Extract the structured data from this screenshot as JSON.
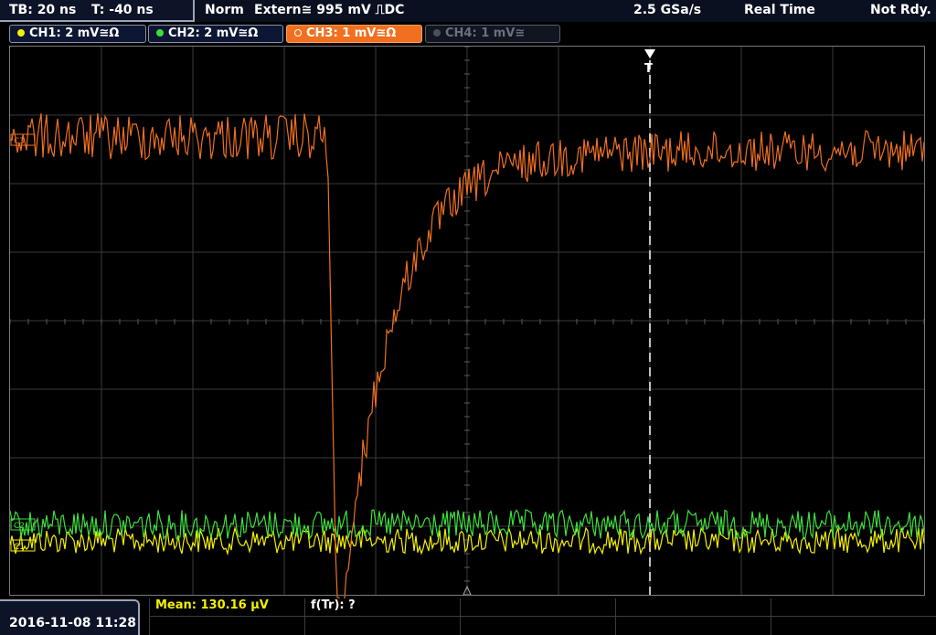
{
  "topbar": {
    "timebase": "TB: 20 ns",
    "trigger_offset": "T: -40 ns",
    "trigger_mode": "Norm",
    "trigger_source": "Extern",
    "trigger_coupling_symbol": "≅",
    "trigger_level": "995 mV",
    "trigger_slope_symbol": "⎍",
    "trigger_coupling": "DC",
    "sample_rate": "2.5 GSa/s",
    "acquisition": "Real Time",
    "status": "Not Rdy."
  },
  "channels": [
    {
      "label": "CH1: 2 mV≅Ω",
      "color": "#f4f000",
      "state": "on"
    },
    {
      "label": "CH2: 2 mV≅Ω",
      "color": "#3ce03c",
      "state": "on"
    },
    {
      "label": "CH3: 1 mV≅Ω",
      "color": "#f07020",
      "state": "active"
    },
    {
      "label": "CH4: 1 mV≅",
      "color": "#6a7080",
      "state": "off"
    }
  ],
  "bottom": {
    "datetime": "2016-11-08 11:28",
    "measurement_1": "Mean: 130.16 µV",
    "measurement_1_color": "#f4f000",
    "measurement_2": "f(Tr): ?"
  },
  "markers": {
    "trigger_marker": "T",
    "ch3_marker": "C3",
    "ch2_marker": "C2",
    "ch1_marker": "C1"
  },
  "colors": {
    "ch1": "#f4f000",
    "ch2": "#3ce03c",
    "ch3": "#f07020",
    "grid": "#3a3a3a",
    "trigger_line": "#ffffff"
  }
}
